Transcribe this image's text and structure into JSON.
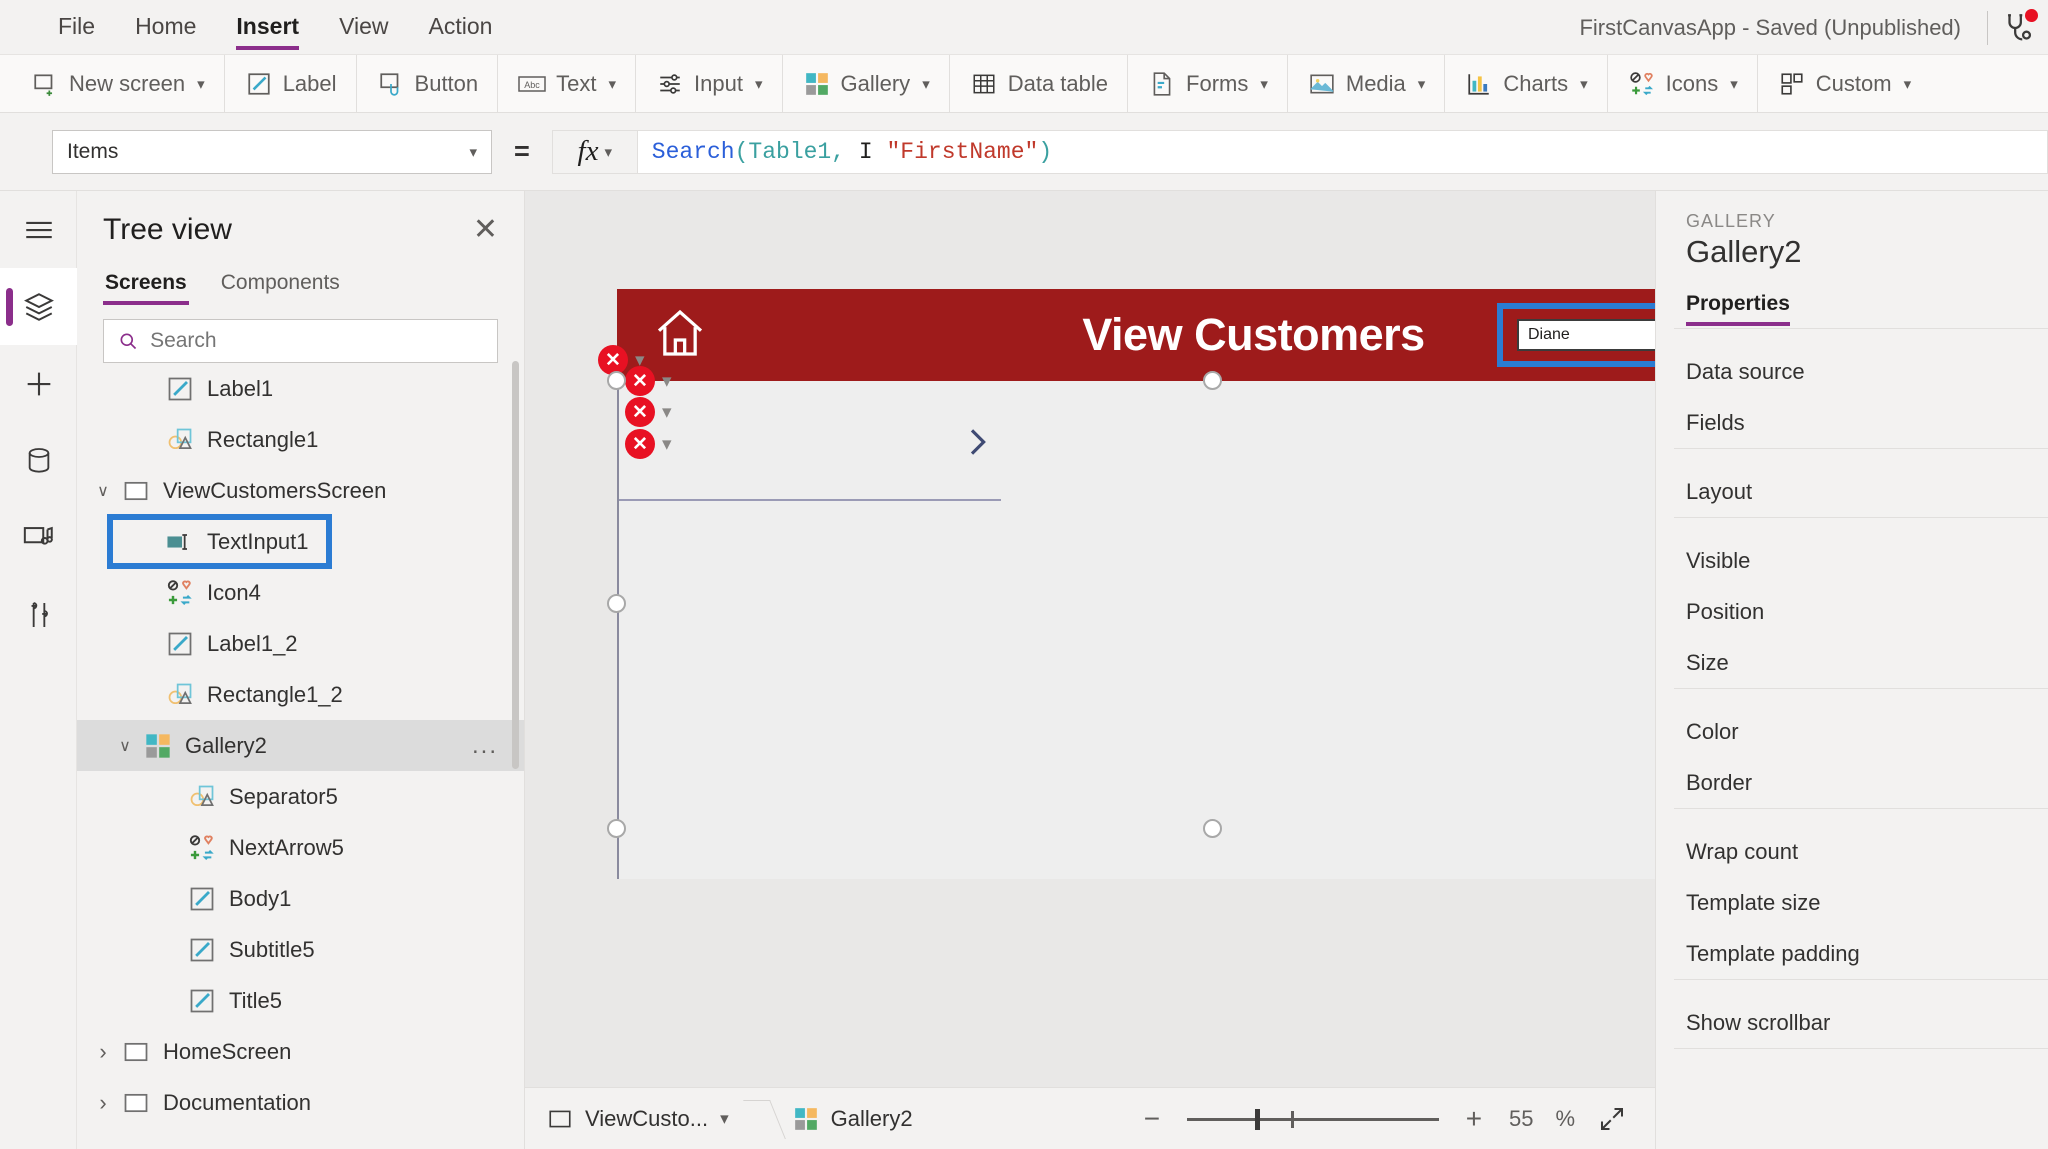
{
  "menubar": {
    "items": [
      {
        "label": "File",
        "active": false
      },
      {
        "label": "Home",
        "active": false
      },
      {
        "label": "Insert",
        "active": true
      },
      {
        "label": "View",
        "active": false
      },
      {
        "label": "Action",
        "active": false
      }
    ],
    "app_status": "FirstCanvasApp - Saved (Unpublished)",
    "checker_icon": "stethoscope-icon"
  },
  "ribbon": {
    "groups": [
      {
        "label": "New screen",
        "icon": "new-screen-icon",
        "caret": true
      },
      {
        "label": "Label",
        "icon": "label-icon",
        "caret": false
      },
      {
        "label": "Button",
        "icon": "button-icon",
        "caret": false
      },
      {
        "label": "Text",
        "icon": "text-abc-icon",
        "caret": true
      },
      {
        "label": "Input",
        "icon": "input-sliders-icon",
        "caret": true
      },
      {
        "label": "Gallery",
        "icon": "gallery-icon",
        "caret": true
      },
      {
        "label": "Data table",
        "icon": "data-table-icon",
        "caret": false
      },
      {
        "label": "Forms",
        "icon": "forms-icon",
        "caret": true
      },
      {
        "label": "Media",
        "icon": "media-image-icon",
        "caret": true
      },
      {
        "label": "Charts",
        "icon": "charts-bar-icon",
        "caret": true
      },
      {
        "label": "Icons",
        "icon": "icons-shapes-icon",
        "caret": true
      },
      {
        "label": "Custom",
        "icon": "custom-blocks-icon",
        "caret": true
      }
    ]
  },
  "formula_bar": {
    "property": "Items",
    "equals": "=",
    "fx_label": "fx",
    "formula_tokens": [
      {
        "text": "Search",
        "type": "fn"
      },
      {
        "text": "(",
        "type": "paren"
      },
      {
        "text": "Table1",
        "type": "tbl"
      },
      {
        "text": ",",
        "type": "plain"
      },
      {
        "text": " ",
        "type": "plain"
      },
      {
        "text": "I",
        "type": "caret"
      },
      {
        "text": " ",
        "type": "plain"
      },
      {
        "text": "\"FirstName\"",
        "type": "str"
      },
      {
        "text": ")",
        "type": "paren"
      }
    ],
    "formula_plain": "Search(Table1, I \"FirstName\")"
  },
  "rail": {
    "items": [
      {
        "name": "hamburger-menu-icon",
        "active": false
      },
      {
        "name": "tree-view-layers-icon",
        "active": true
      },
      {
        "name": "insert-plus-icon",
        "active": false
      },
      {
        "name": "data-cylinder-icon",
        "active": false
      },
      {
        "name": "media-icon",
        "active": false
      },
      {
        "name": "advanced-tools-icon",
        "active": false
      }
    ]
  },
  "tree_view": {
    "title": "Tree view",
    "close_icon": "close-icon",
    "tabs": [
      {
        "label": "Screens",
        "active": true
      },
      {
        "label": "Components",
        "active": false
      }
    ],
    "search_placeholder": "Search",
    "search_value": "",
    "search_icon": "search-icon",
    "nodes": [
      {
        "label": "Label1",
        "icon": "label-icon",
        "indent": 2,
        "chevron": "",
        "selected": false,
        "boxed": false,
        "dots": false
      },
      {
        "label": "Rectangle1",
        "icon": "shape-icon",
        "indent": 2,
        "chevron": "",
        "selected": false,
        "boxed": false,
        "dots": false
      },
      {
        "label": "ViewCustomersScreen",
        "icon": "screen-icon",
        "indent": 0,
        "chevron": "expanded",
        "selected": false,
        "boxed": false,
        "dots": false
      },
      {
        "label": "TextInput1",
        "icon": "text-input-icon",
        "indent": 2,
        "chevron": "",
        "selected": false,
        "boxed": true,
        "dots": false
      },
      {
        "label": "Icon4",
        "icon": "icons-shapes-icon",
        "indent": 2,
        "chevron": "",
        "selected": false,
        "boxed": false,
        "dots": false
      },
      {
        "label": "Label1_2",
        "icon": "label-icon",
        "indent": 2,
        "chevron": "",
        "selected": false,
        "boxed": false,
        "dots": false
      },
      {
        "label": "Rectangle1_2",
        "icon": "shape-icon",
        "indent": 2,
        "chevron": "",
        "selected": false,
        "boxed": false,
        "dots": false
      },
      {
        "label": "Gallery2",
        "icon": "gallery-icon",
        "indent": 1,
        "chevron": "expanded",
        "selected": true,
        "boxed": false,
        "dots": true
      },
      {
        "label": "Separator5",
        "icon": "shape-icon",
        "indent": 3,
        "chevron": "",
        "selected": false,
        "boxed": false,
        "dots": false
      },
      {
        "label": "NextArrow5",
        "icon": "icons-shapes-icon",
        "indent": 3,
        "chevron": "",
        "selected": false,
        "boxed": false,
        "dots": false
      },
      {
        "label": "Body1",
        "icon": "label-icon",
        "indent": 3,
        "chevron": "",
        "selected": false,
        "boxed": false,
        "dots": false
      },
      {
        "label": "Subtitle5",
        "icon": "label-icon",
        "indent": 3,
        "chevron": "",
        "selected": false,
        "boxed": false,
        "dots": false
      },
      {
        "label": "Title5",
        "icon": "label-icon",
        "indent": 3,
        "chevron": "",
        "selected": false,
        "boxed": false,
        "dots": false
      },
      {
        "label": "HomeScreen",
        "icon": "screen-icon",
        "indent": 0,
        "chevron": "collapsed",
        "selected": false,
        "boxed": false,
        "dots": false
      },
      {
        "label": "Documentation",
        "icon": "screen-icon",
        "indent": 0,
        "chevron": "collapsed",
        "selected": false,
        "boxed": false,
        "dots": false
      }
    ],
    "node_more_label": "..."
  },
  "canvas": {
    "app_header": {
      "title": "View Customers",
      "bg_color": "#9e1b1b",
      "home_icon": "home-icon"
    },
    "text_input": {
      "value": "Diane",
      "selected": true,
      "selection_color": "#2b7cd3"
    },
    "gallery": {
      "next_arrow_icon": "chevron-right-icon",
      "selected": true
    },
    "error_badges": [
      {
        "glyph": "✕",
        "chevron": "∨"
      },
      {
        "glyph": "✕",
        "chevron": "∨"
      },
      {
        "glyph": "✕",
        "chevron": "∨"
      },
      {
        "glyph": "✕",
        "chevron": "∨"
      }
    ]
  },
  "properties_panel": {
    "kicker": "GALLERY",
    "name": "Gallery2",
    "tabs": [
      {
        "label": "Properties",
        "active": true
      }
    ],
    "groups": [
      {
        "rows": [
          "Data source",
          "Fields"
        ]
      },
      {
        "rows": [
          "Layout"
        ]
      },
      {
        "rows": [
          "Visible",
          "Position",
          "Size"
        ]
      },
      {
        "rows": [
          "Color",
          "Border"
        ]
      },
      {
        "rows": [
          "Wrap count",
          "Template size",
          "Template padding"
        ]
      },
      {
        "rows": [
          "Show scrollbar"
        ]
      }
    ]
  },
  "status_bar": {
    "breadcrumb": [
      {
        "label": "ViewCusto...",
        "icon": "screen-icon",
        "caret": true
      },
      {
        "label": "Gallery2",
        "icon": "gallery-icon",
        "caret": false
      }
    ],
    "zoom_out": "−",
    "zoom_in": "+",
    "zoom_value": "55",
    "zoom_unit": "%",
    "expand_icon": "fit-screen-icon"
  }
}
